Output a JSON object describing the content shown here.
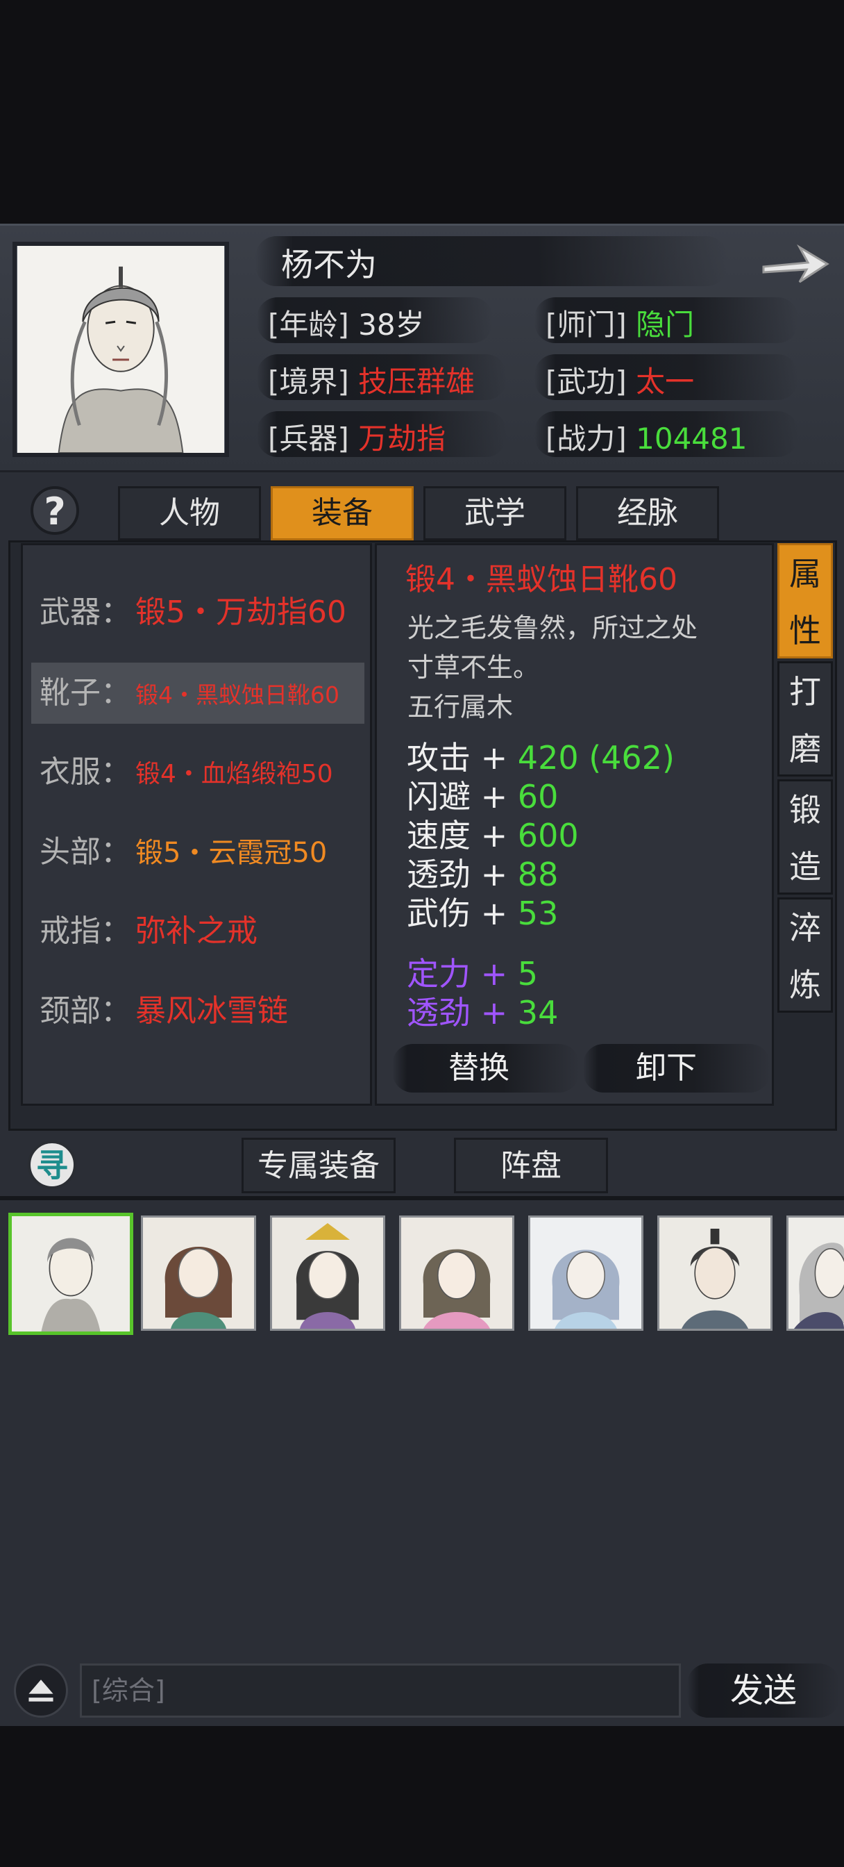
{
  "character": {
    "name": "杨不为",
    "fields": [
      {
        "label": "[年龄]",
        "value": "38岁",
        "color": "#e4e4e4"
      },
      {
        "label": "[师门]",
        "value": "隐门",
        "color": "#49dd3c"
      },
      {
        "label": "[境界]",
        "value": "技压群雄",
        "color": "#e4322a"
      },
      {
        "label": "[武功]",
        "value": "太一",
        "color": "#e4322a"
      },
      {
        "label": "[兵器]",
        "value": "万劫指",
        "color": "#e4322a"
      },
      {
        "label": "[战力]",
        "value": "104481",
        "color": "#49dd3c"
      }
    ]
  },
  "help_icon": "question-icon",
  "tabs": [
    {
      "label": "人物",
      "active": false
    },
    {
      "label": "装备",
      "active": true
    },
    {
      "label": "武学",
      "active": false
    },
    {
      "label": "经脉",
      "active": false
    }
  ],
  "equipment": [
    {
      "slot": "武器：",
      "item": "锻5・万劫指60",
      "color": "#e4322a"
    },
    {
      "slot": "靴子：",
      "item": "锻4・黑蚁蚀日靴60",
      "color": "#e4322a",
      "selected": true
    },
    {
      "slot": "衣服：",
      "item": "锻4・血焰缎袍50",
      "color": "#e4322a"
    },
    {
      "slot": "头部：",
      "item": "锻5・云霞冠50",
      "color": "#f08a22"
    },
    {
      "slot": "戒指：",
      "item": "弥补之戒",
      "color": "#e4322a"
    },
    {
      "slot": "颈部：",
      "item": "暴风冰雪链",
      "color": "#e4322a"
    }
  ],
  "detail": {
    "title": "锻4・黑蚁蚀日靴60",
    "description_lines": [
      "光之毛发鲁然，所过之处",
      "寸草不生。",
      "五行属木"
    ],
    "stats": [
      {
        "label": "攻击",
        "plus": "+",
        "value": "420 (462)"
      },
      {
        "label": "闪避",
        "plus": "+",
        "value": "60"
      },
      {
        "label": "速度",
        "plus": "+",
        "value": "600"
      },
      {
        "label": "透劲",
        "plus": "+",
        "value": "88"
      },
      {
        "label": "武伤",
        "plus": "+",
        "value": "53"
      }
    ],
    "extra_stats": [
      {
        "label": "定力",
        "plus": "+",
        "value": "5"
      },
      {
        "label": "透劲",
        "plus": "+",
        "value": "34"
      }
    ],
    "replace_label": "替换",
    "unequip_label": "卸下"
  },
  "side_tabs": [
    {
      "chars": [
        "属",
        "性"
      ],
      "active": true
    },
    {
      "chars": [
        "打",
        "磨"
      ],
      "active": false
    },
    {
      "chars": [
        "锻",
        "造"
      ],
      "active": false
    },
    {
      "chars": [
        "淬",
        "炼"
      ],
      "active": false
    }
  ],
  "lower": {
    "find_icon": "寻",
    "exclusive_equipment_label": "专属装备",
    "formation_label": "阵盘"
  },
  "roster": {
    "count": 7,
    "selected_index": 0
  },
  "chat": {
    "placeholder": "[综合]",
    "send_label": "发送"
  },
  "colors": {
    "accent_orange": "#e0901c",
    "green": "#49dd3c",
    "red": "#e4322a",
    "purple": "#a055ff",
    "panel": "#2b2e36"
  }
}
